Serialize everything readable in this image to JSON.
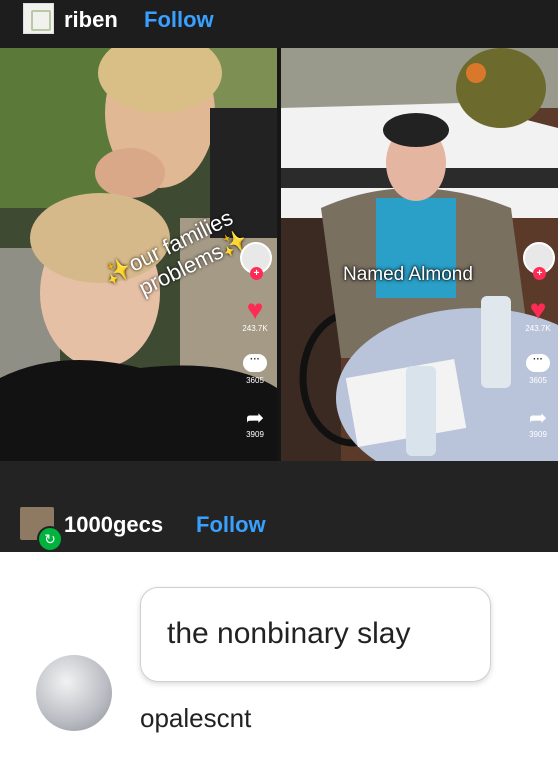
{
  "post1": {
    "username": "riben",
    "follow_label": "Follow"
  },
  "video_left": {
    "caption_line1": "✨our families",
    "caption_line2": "problems✨",
    "likes": "243.7K",
    "comments": "3605",
    "shares": "3909"
  },
  "video_right": {
    "caption": "Named Almond",
    "likes": "243.7K",
    "comments": "3605",
    "shares": "3909"
  },
  "post2": {
    "username": "1000gecs",
    "follow_label": "Follow"
  },
  "comment": {
    "text": "the nonbinary slay",
    "author": "opalescnt"
  }
}
